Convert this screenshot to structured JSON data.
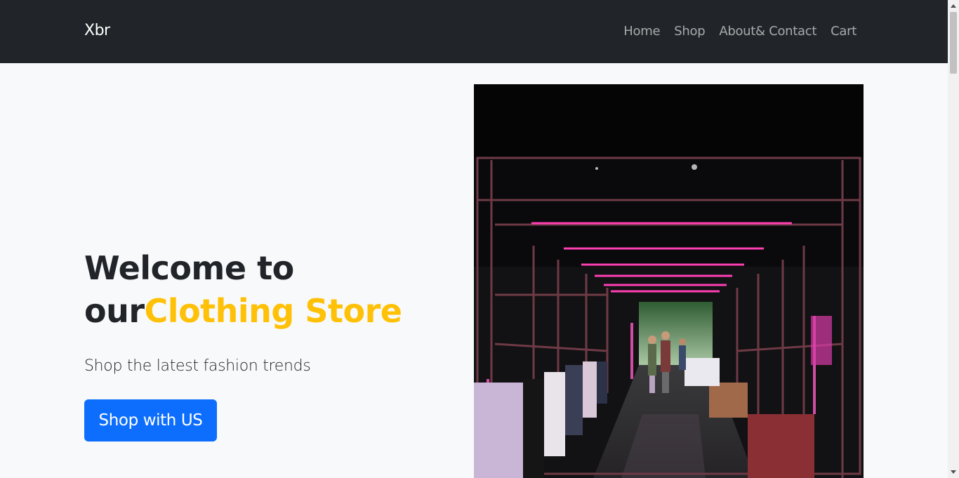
{
  "navbar": {
    "brand": "Xbr",
    "links": [
      "Home",
      "Shop",
      "About& Contact",
      "Cart"
    ]
  },
  "hero": {
    "headline_line1": "Welcome to",
    "headline_prefix": "our",
    "headline_accent": "Clothing Store",
    "subtitle": "Shop the latest fashion trends",
    "button": "Shop with US"
  },
  "colors": {
    "navbar_bg": "#212529",
    "accent": "#ffc107",
    "primary": "#0d6efd",
    "page_bg": "#f8f9fa"
  }
}
